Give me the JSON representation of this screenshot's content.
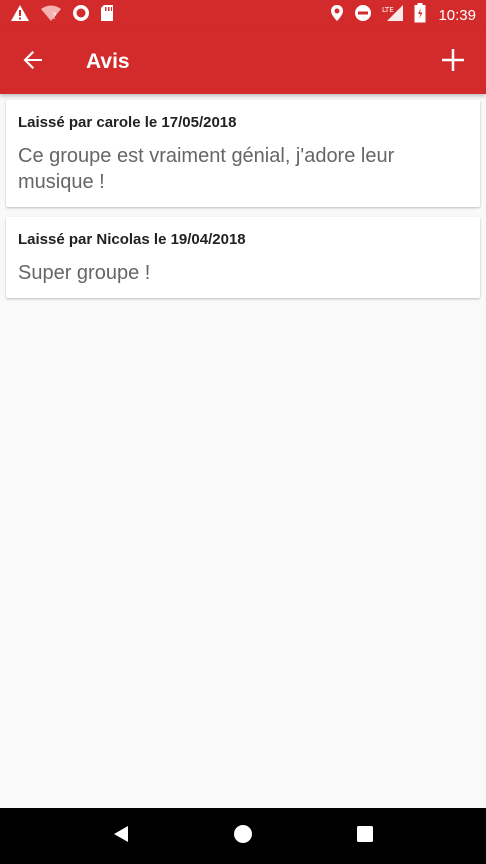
{
  "status_bar": {
    "time": "10:39",
    "left_icons": [
      "warning-icon",
      "wifi-question-icon",
      "record-icon",
      "sd-card-icon"
    ],
    "right_icons": [
      "location-icon",
      "do-not-disturb-icon",
      "lte-signal-icon",
      "battery-icon"
    ],
    "lte_label": "LTE"
  },
  "app_bar": {
    "title": "Avis",
    "back_icon": "arrow-back-icon",
    "add_icon": "plus-icon",
    "background": "#d32b2b"
  },
  "reviews": [
    {
      "meta": "Laissé par carole le 17/05/2018",
      "text": "Ce groupe est vraiment génial, j'adore leur musique !"
    },
    {
      "meta": "Laissé par Nicolas le 19/04/2018",
      "text": "Super groupe !"
    }
  ],
  "nav_bar": {
    "icons": [
      "back-triangle-icon",
      "home-circle-icon",
      "recents-square-icon"
    ]
  }
}
